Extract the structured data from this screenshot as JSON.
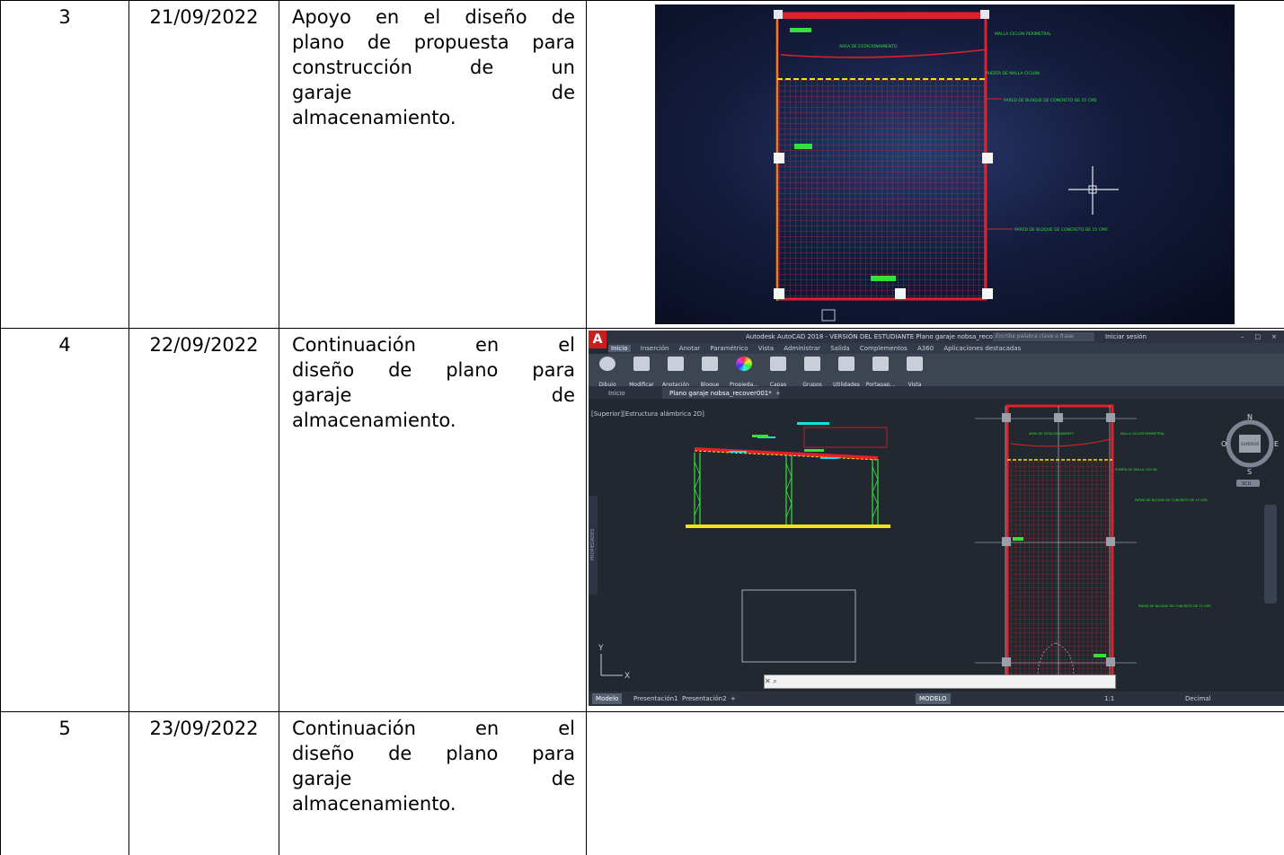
{
  "rows": [
    {
      "num": "3",
      "date": "21/09/2022",
      "desc_lines": [
        "Apoyo en el diseño de",
        "plano de propuesta para",
        "construcción de un",
        "garaje de",
        "almacenamiento."
      ]
    },
    {
      "num": "4",
      "date": "22/09/2022",
      "desc_lines": [
        "Continuación en el",
        "diseño de plano para",
        "garaje de",
        "almacenamiento."
      ]
    },
    {
      "num": "5",
      "date": "23/09/2022",
      "desc_lines": [
        "Continuación en el",
        "diseño de plano para",
        "garaje de",
        "almacenamiento."
      ]
    }
  ],
  "photo1": {
    "labels": {
      "a": "AREA DE ESTACIONAMIENTO",
      "b": "MALLA CICLON PERIMETRAL",
      "c": "PUERTA DE MALLA CICLON",
      "d": "PARED DE BLOQUE DE CONCRETO DE 15 CMS",
      "e": "PARED DE BLOQUE DE CONCRETO DE 15 CMS"
    }
  },
  "acad": {
    "logo": "A",
    "title": "Autodesk AutoCAD 2018 - VERSIÓN DEL ESTUDIANTE   Plano garaje nobsa_recover001.dwg",
    "search_placeholder": "Escriba palabra clave o frase",
    "login": "Iniciar sesión",
    "ribbon_tabs": [
      "Inicio",
      "Inserción",
      "Anotar",
      "Paramétrico",
      "Vista",
      "Administrar",
      "Salida",
      "Complementos",
      "A360",
      "Aplicaciones destacadas"
    ],
    "ribbon_buttons": [
      "Dibujo",
      "Modificar",
      "Anotación",
      "Bloque",
      "Propieda...",
      "Capas",
      "Grupos",
      "Utilidades",
      "Portapap...",
      "Vista"
    ],
    "doc_tabs": [
      "Inicio",
      "Plano garaje nobsa_recover001*",
      "+"
    ],
    "view_label": "[Superior][Estructura alámbrica 2D]",
    "compass": {
      "n": "N",
      "s": "S",
      "e": "E",
      "o": "O",
      "center": "SUPERIOR",
      "scu": "SCU"
    },
    "side_panel": "PROPIEDADES",
    "axis_y": "Y",
    "axis_x": "X",
    "layout_tabs": [
      "Modelo",
      "Presentación1",
      "Presentación2",
      "+"
    ],
    "status_items": [
      "MODELO",
      "1:1",
      "Decimal"
    ],
    "plan_labels": {
      "a": "AREA DE ESTACIONAMIENTO",
      "b": "MALLA CICLON PERIMETRAL",
      "c": "PUERTA DE MALLA CICLON",
      "d": "PARED DE BLOQUE DE CONCRETO DE 15 CMS",
      "e": "PARED DE BLOQUE DE CONCRETO DE 15 CMS"
    }
  },
  "colors": {
    "plan_red": "#e0202a",
    "plan_green": "#36e03a",
    "plan_yellow": "#f2e312",
    "acad_bg": "#212830",
    "cyan": "#10e0e8"
  }
}
